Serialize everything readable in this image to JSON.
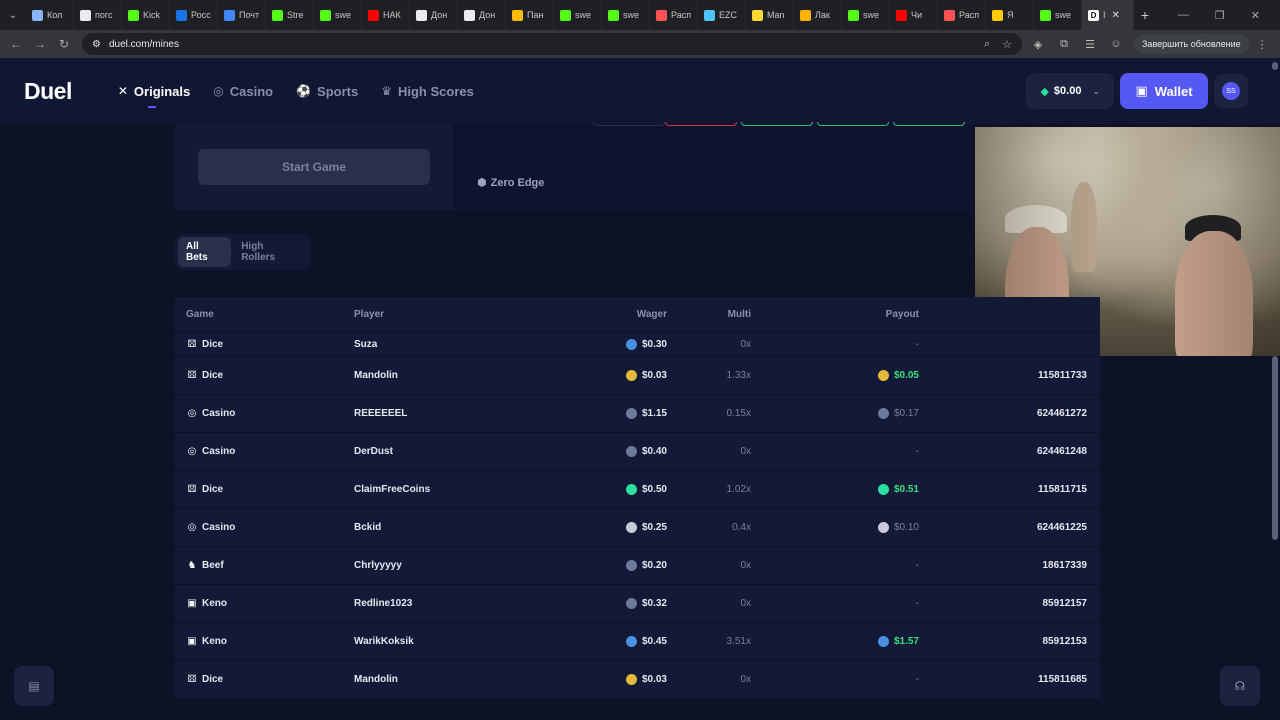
{
  "browser": {
    "tabs": [
      {
        "label": "Кол",
        "color": "#8ab4f8"
      },
      {
        "label": "погс",
        "color": "#e8eaed"
      },
      {
        "label": "Kick",
        "color": "#53fc18"
      },
      {
        "label": "Росс",
        "color": "#1a73e8"
      },
      {
        "label": "Почт",
        "color": "#4285f4"
      },
      {
        "label": "Stre",
        "color": "#53fc18"
      },
      {
        "label": "swe",
        "color": "#53fc18"
      },
      {
        "label": "НАК",
        "color": "#ff0000"
      },
      {
        "label": "Дон",
        "color": "#e8eaed"
      },
      {
        "label": "Дон",
        "color": "#e8eaed"
      },
      {
        "label": "Пан",
        "color": "#fbbc04"
      },
      {
        "label": "swe",
        "color": "#53fc18"
      },
      {
        "label": "swe",
        "color": "#53fc18"
      },
      {
        "label": "Расп",
        "color": "#ff5252"
      },
      {
        "label": "EZC",
        "color": "#4fc3f7"
      },
      {
        "label": "Man",
        "color": "#fdd835"
      },
      {
        "label": "Лак",
        "color": "#ffb300"
      },
      {
        "label": "swe",
        "color": "#53fc18"
      },
      {
        "label": "Чи",
        "color": "#ff0000"
      },
      {
        "label": "Расп",
        "color": "#ff5252"
      },
      {
        "label": "Я",
        "color": "#ffcc00"
      },
      {
        "label": "swe",
        "color": "#53fc18"
      }
    ],
    "active_tab": {
      "icon": "D",
      "label": "I",
      "close": "✕"
    },
    "new_tab": "+",
    "url": "duel.com/mines",
    "update_label": "Завершить обновление"
  },
  "header": {
    "logo": "Duel",
    "nav": [
      {
        "label": "Originals",
        "icon": "✕",
        "active": true
      },
      {
        "label": "Casino",
        "icon": "◎",
        "active": false
      },
      {
        "label": "Sports",
        "icon": "⚽",
        "active": false
      },
      {
        "label": "High Scores",
        "icon": "♛",
        "active": false
      }
    ],
    "balance": "$0.00",
    "wallet_label": "Wallet",
    "avatar_initials": "SS"
  },
  "game": {
    "start_label": "Start Game",
    "zero_edge_label": "Zero Edge"
  },
  "bets": {
    "tabs": [
      {
        "label": "All Bets",
        "active": true
      },
      {
        "label": "High Rollers",
        "active": false
      }
    ],
    "columns": {
      "game": "Game",
      "player": "Player",
      "wager": "Wager",
      "multi": "Multi",
      "payout": "Payout"
    },
    "rows": [
      {
        "game": "Dice",
        "game_icon": "dice-icon",
        "player": "Suza",
        "coin": "#4a90e2",
        "wager": "$0.30",
        "multi": "0x",
        "payout": "-",
        "win": false,
        "id": ""
      },
      {
        "game": "Dice",
        "game_icon": "dice-icon",
        "player": "Mandolin",
        "coin": "#e2b93b",
        "wager": "$0.03",
        "multi": "1.33x",
        "payout": "$0.05",
        "win": true,
        "id": "115811733"
      },
      {
        "game": "Casino",
        "game_icon": "casino-icon",
        "player": "REEEEEEL",
        "coin": "#6b7a9a",
        "wager": "$1.15",
        "multi": "0.15x",
        "payout": "$0.17",
        "win": false,
        "id": "624461272"
      },
      {
        "game": "Casino",
        "game_icon": "casino-icon",
        "player": "DerDust",
        "coin": "#6b7a9a",
        "wager": "$0.40",
        "multi": "0x",
        "payout": "-",
        "win": false,
        "id": "624461248"
      },
      {
        "game": "Dice",
        "game_icon": "dice-icon",
        "player": "ClaimFreeCoins",
        "coin": "#2ee0a0",
        "wager": "$0.50",
        "multi": "1.02x",
        "payout": "$0.51",
        "win": true,
        "id": "115811715"
      },
      {
        "game": "Casino",
        "game_icon": "casino-icon",
        "player": "Bckid",
        "coin": "#c9ccd6",
        "wager": "$0.25",
        "multi": "0.4x",
        "payout": "$0.10",
        "win": false,
        "id": "624461225"
      },
      {
        "game": "Beef",
        "game_icon": "beef-icon",
        "player": "Chrlyyyyy",
        "coin": "#6b7a9a",
        "wager": "$0.20",
        "multi": "0x",
        "payout": "-",
        "win": false,
        "id": "18617339"
      },
      {
        "game": "Keno",
        "game_icon": "keno-icon",
        "player": "Redline1023",
        "coin": "#6b7a9a",
        "wager": "$0.32",
        "multi": "0x",
        "payout": "-",
        "win": false,
        "id": "85912157"
      },
      {
        "game": "Keno",
        "game_icon": "keno-icon",
        "player": "WarikKoksik",
        "coin": "#4a90e2",
        "wager": "$0.45",
        "multi": "3.51x",
        "payout": "$1.57",
        "win": true,
        "id": "85912153"
      },
      {
        "game": "Dice",
        "game_icon": "dice-icon",
        "player": "Mandolin",
        "coin": "#e2b93b",
        "wager": "$0.03",
        "multi": "0x",
        "payout": "-",
        "win": false,
        "id": "115811685"
      }
    ]
  },
  "colors": {
    "accent": "#5558f2",
    "win": "#39e07a",
    "bg": "#0d1226"
  }
}
